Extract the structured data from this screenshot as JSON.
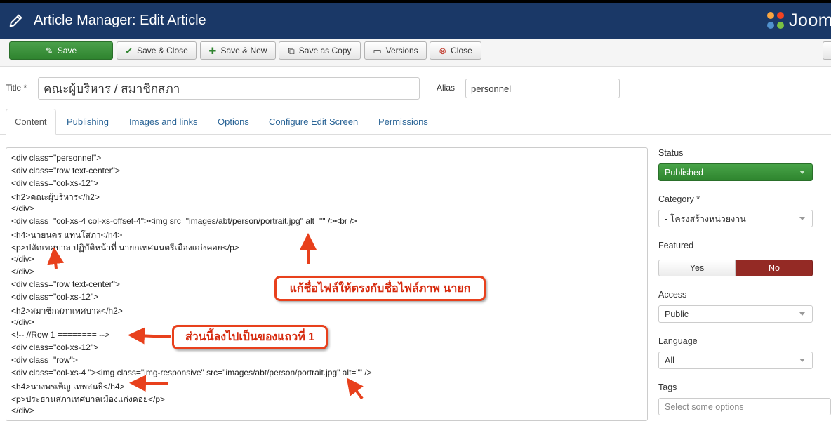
{
  "header": {
    "title": "Article Manager: Edit Article",
    "logo_text": "Joom",
    "background": "#1a3867"
  },
  "toolbar": {
    "save": "Save",
    "save_close": "Save & Close",
    "save_new": "Save & New",
    "save_copy": "Save as Copy",
    "versions": "Versions",
    "close": "Close",
    "save_color": "#3a933a"
  },
  "form": {
    "title_label": "Title *",
    "title_value": "คณะผู้บริหาร / สมาชิกสภา",
    "alias_label": "Alias",
    "alias_value": "personnel"
  },
  "tabs": [
    "Content",
    "Publishing",
    "Images and links",
    "Options",
    "Configure Edit Screen",
    "Permissions"
  ],
  "editor_lines": [
    "<div class=\"personnel\">",
    "<div class=\"row text-center\">",
    "<div class=\"col-xs-12\">",
    "<h2>คณะผู้บริหาร</h2>",
    "</div>",
    "<div class=\"col-xs-4 col-xs-offset-4\"><img src=\"images/abt/person/portrait.jpg\" alt=\"\" /><br />",
    "<h4>นายนคร แทนโสภา</h4>",
    "<p>ปลัดเทศบาล ปฏิบัติหน้าที่ นายกเทศมนตรีเมืองแก่งคอย</p>",
    "</div>",
    "</div>",
    "<div class=\"row text-center\">",
    "<div class=\"col-xs-12\">",
    "<h2>สมาชิกสภาเทศบาล</h2>",
    "</div>",
    "<!-- //Row 1 ======== -->",
    "<div class=\"col-xs-12\">",
    "<div class=\"row\">",
    "<div class=\"col-xs-4 \"><img class=\"img-responsive\" src=\"images/abt/person/portrait.jpg\" alt=\"\" />",
    "<h4>นางพรเพ็ญ เทพสนธิ</h4>",
    "<p>ประธานสภาเทศบาลเมืองแก่งคอย</p>",
    "</div>"
  ],
  "sidebar": {
    "status_label": "Status",
    "status_value": "Published",
    "category_label": "Category *",
    "category_value": "- โครงสร้างหน่วยงาน",
    "featured_label": "Featured",
    "featured_yes": "Yes",
    "featured_no": "No",
    "access_label": "Access",
    "access_value": "Public",
    "language_label": "Language",
    "language_value": "All",
    "tags_label": "Tags",
    "tags_placeholder": "Select some options"
  },
  "annotations": {
    "callout_1": "แก้ชื่อไฟล์ให้ตรงกับชื่อไฟล์ภาพ นายก",
    "callout_2": "ส่วนนี้ลงไปเป็นของแถวที่ 1",
    "color": "#e8401c"
  }
}
